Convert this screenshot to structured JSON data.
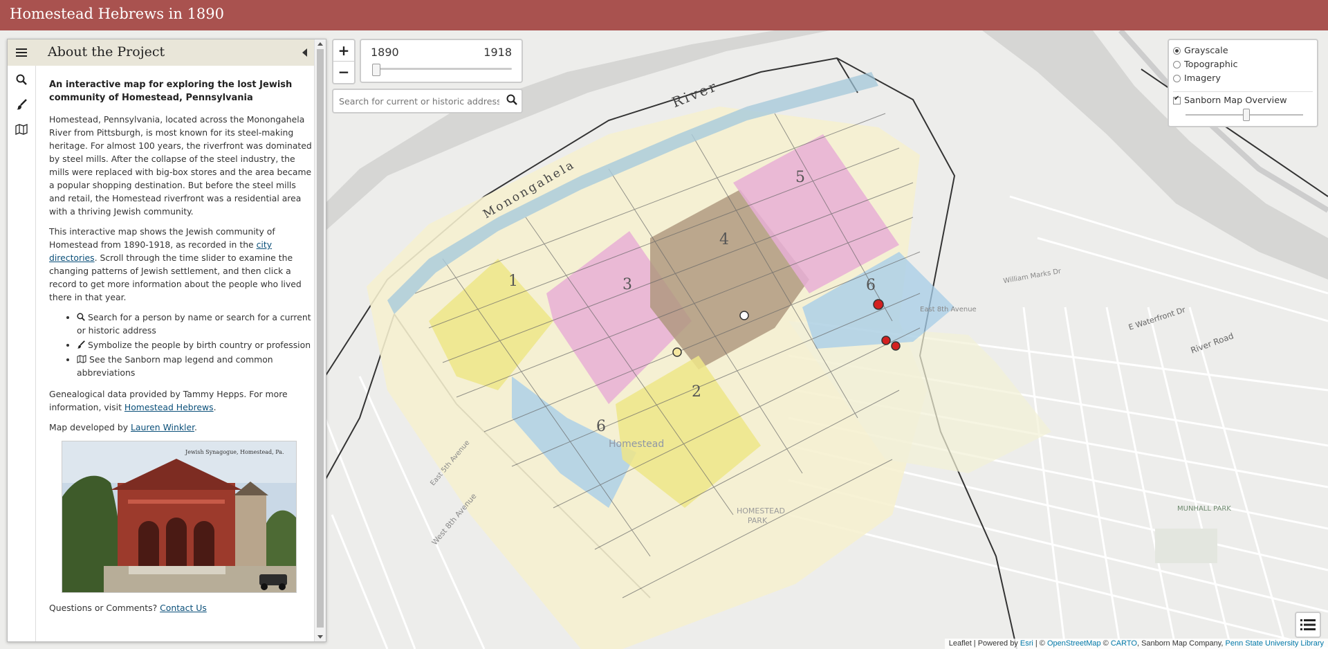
{
  "header": {
    "title": "Homestead Hebrews in 1890"
  },
  "sidebar": {
    "tabs": [
      {
        "icon": "hamburger-icon"
      },
      {
        "icon": "search-icon"
      },
      {
        "icon": "paintbrush-icon"
      },
      {
        "icon": "map-icon"
      }
    ],
    "pane_title": "About the Project",
    "lead": "An interactive map for exploring the lost Jewish community of Homestead, Pennsylvania",
    "p1": "Homestead, Pennsylvania, located across the Monongahela River from Pittsburgh, is most known for its steel-making heritage. For almost 100 years, the riverfront was dominated by steel mills. After the collapse of the steel industry, the mills were replaced with big-box stores and the area became a popular shopping destination. But before the steel mills and retail, the Homestead riverfront was a residential area with a thriving Jewish community.",
    "p2_before": "This interactive map shows the Jewish community of Homestead from 1890-1918, as recorded in the ",
    "p2_link": "city directories",
    "p2_after": ". Scroll through the time slider to examine the changing patterns of Jewish settlement, and then click a record to get more information about the people who lived there in that year.",
    "bullets": [
      "Search for a person by name or search for a current or historic address",
      "Symbolize the people by birth country or profession",
      "See the Sanborn map legend and common abbreviations"
    ],
    "credit_before": "Genealogical data provided by Tammy Hepps. For more information, visit ",
    "credit_link": "Homestead Hebrews",
    "credit_after": ".",
    "dev_before": "Map developed by ",
    "dev_link": "Lauren Winkler",
    "dev_after": ".",
    "postcard_caption": "Jewish Synagogue, Homestead, Pa.",
    "contact_before": "Questions or Comments? ",
    "contact_link": "Contact Us"
  },
  "zoom": {
    "in": "+",
    "out": "−"
  },
  "time_slider": {
    "start": "1890",
    "end": "1918",
    "value_fraction": 0
  },
  "search": {
    "placeholder": "Search for current or historic addresses"
  },
  "layers": {
    "basemaps": [
      {
        "label": "Grayscale",
        "selected": true
      },
      {
        "label": "Topographic",
        "selected": false
      },
      {
        "label": "Imagery",
        "selected": false
      }
    ],
    "overlay": {
      "label": "Sanborn Map Overview",
      "checked": true,
      "opacity_fraction": 0.5
    }
  },
  "map_labels": {
    "river": "River",
    "monongahela": "Monongahela",
    "homestead": "Homestead",
    "homestead_park": "HOMESTEAD PARK",
    "munhall_park": "MUNHALL PARK",
    "river_road": "River Road",
    "e_waterfront": "E Waterfront Dr",
    "e_8th": "East 8th Avenue",
    "w_8th": "West 8th Avenue",
    "e_5th": "East 5th Avenue",
    "william_marks": "William Marks Dr",
    "sanborn_blocks": [
      "1",
      "3",
      "4",
      "5",
      "6",
      "2",
      "6"
    ]
  },
  "attribution": {
    "leaflet": "Leaflet",
    "powered": " | Powered by ",
    "esri": "Esri",
    "sep": " | © ",
    "osm": "OpenStreetMap",
    "c2": " © ",
    "carto": "CARTO",
    "sanborn": ", Sanborn Map Company, ",
    "psu": "Penn State University Library"
  },
  "colors": {
    "header": "#a9524f",
    "pink": "#e7a7d2",
    "yellow": "#efe57a",
    "brown": "#a48a6c",
    "blue": "#a4cde6",
    "marker_red": "#d32020"
  }
}
